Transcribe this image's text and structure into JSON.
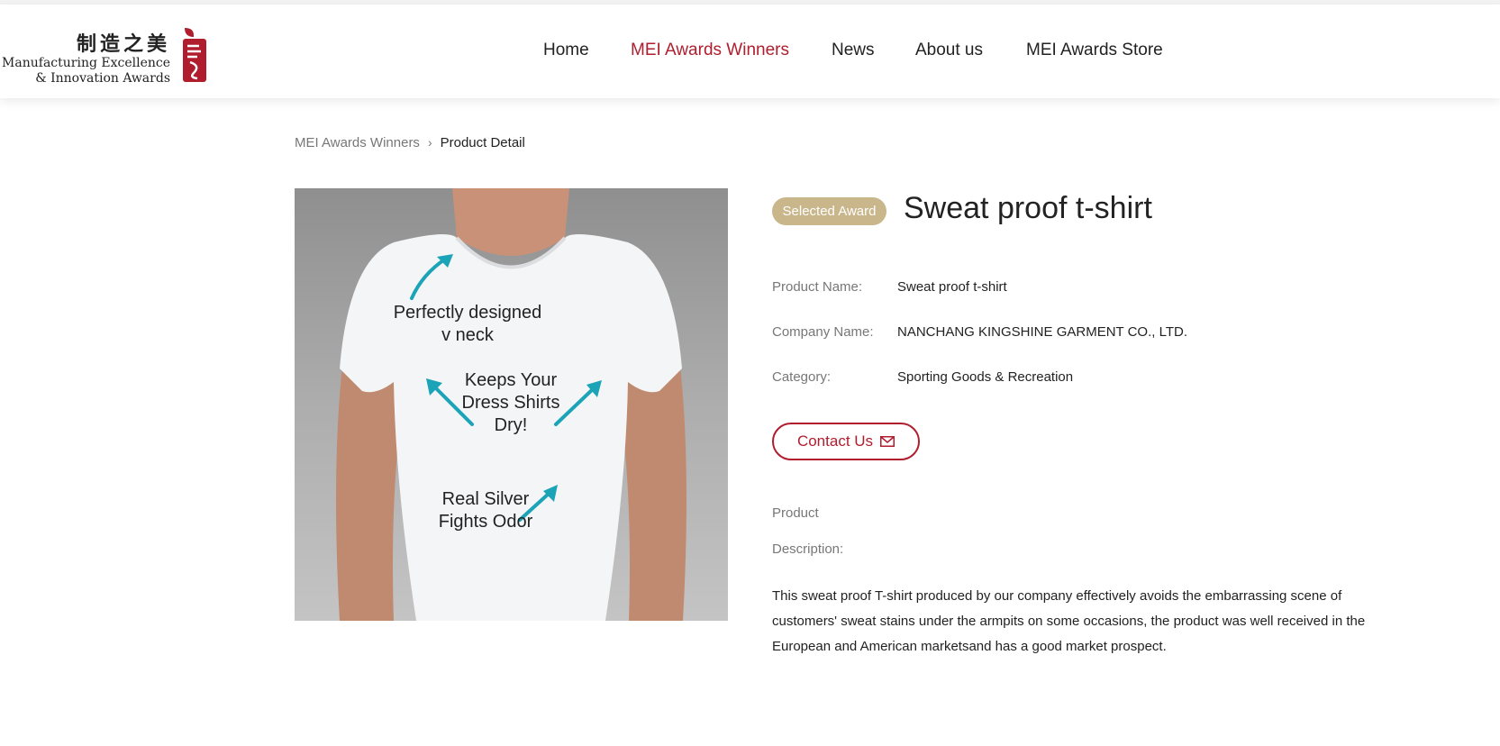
{
  "logo": {
    "cn_text": "制造之美",
    "en_line1": "Manufacturing Excellence",
    "en_line2": "& Innovation Awards",
    "mark_icon": "mei-brand-mark",
    "brand_color": "#b01e2e"
  },
  "nav": {
    "items": [
      {
        "label": "Home",
        "active": false
      },
      {
        "label": "MEI Awards Winners",
        "active": true
      },
      {
        "label": "News",
        "active": false
      },
      {
        "label": "About us",
        "active": false
      },
      {
        "label": "MEI Awards Store",
        "active": false
      }
    ],
    "active_color": "#b01e2e"
  },
  "breadcrumb": {
    "parent": "MEI Awards Winners",
    "separator_icon": "chevron-right-icon",
    "current": "Product Detail"
  },
  "product_image": {
    "annotations": [
      "Perfectly designed",
      "v neck",
      "Keeps Your",
      "Dress Shirts",
      "Dry!",
      "Real Silver",
      "Fights Odor"
    ],
    "arrow_color": "#1ba3b8"
  },
  "product": {
    "badge": "Selected Award",
    "badge_color": "#c9b68a",
    "title": "Sweat proof t-shirt",
    "fields": [
      {
        "label": "Product Name:",
        "value": "Sweat proof t-shirt"
      },
      {
        "label": "Company Name:",
        "value": "NANCHANG KINGSHINE GARMENT CO., LTD."
      },
      {
        "label": "Category:",
        "value": "Sporting Goods & Recreation"
      }
    ],
    "contact_label": "Contact Us",
    "contact_icon": "mail-icon",
    "description_label_line1": "Product",
    "description_label_line2": "Description:",
    "description": "This sweat proof T-shirt produced by our company effectively avoids the embarrassing scene of customers' sweat stains under the armpits on some occasions, the product was well received in the European and American marketsand has a good market prospect."
  }
}
